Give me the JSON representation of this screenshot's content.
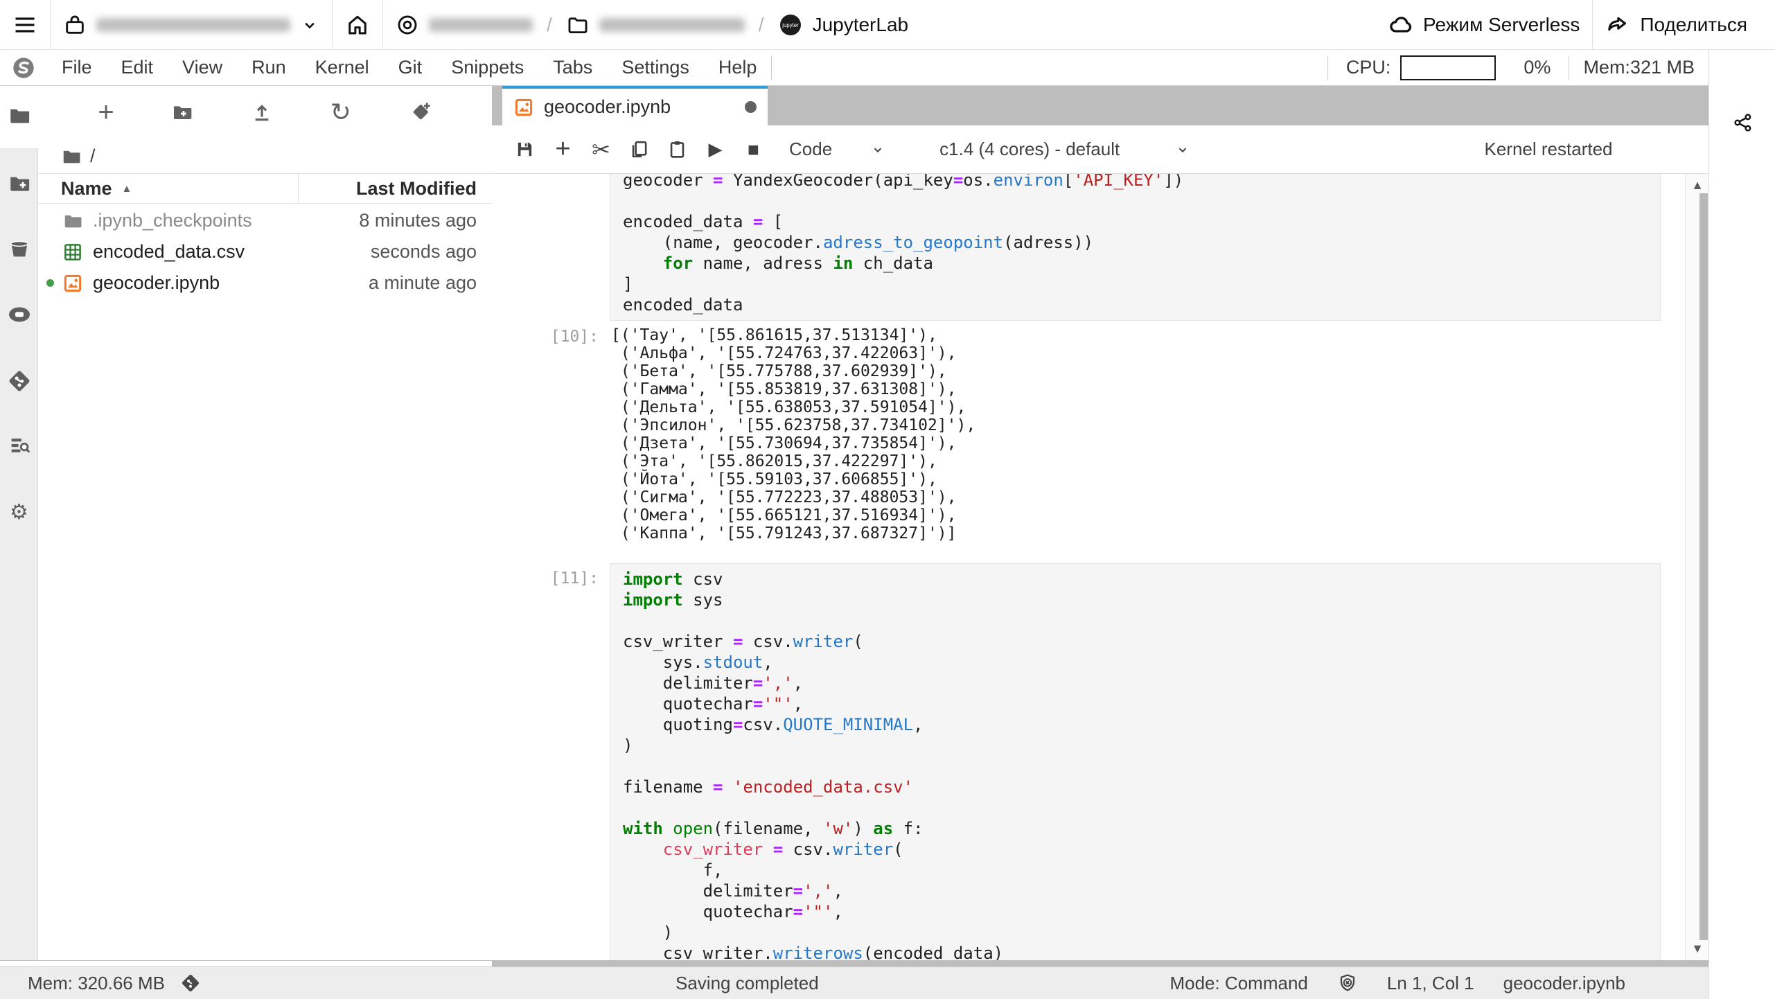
{
  "topbar": {
    "app_title": "JupyterLab",
    "breadcrumb_sep": "/",
    "serverless_label": "Режим Serverless",
    "share_label": "Поделиться"
  },
  "menubar": {
    "items": [
      "File",
      "Edit",
      "View",
      "Run",
      "Kernel",
      "Git",
      "Snippets",
      "Tabs",
      "Settings",
      "Help"
    ],
    "cpu_label": "CPU:",
    "cpu_value": "0%",
    "mem_label": "Mem:321 MB"
  },
  "filebrowser": {
    "path": "/",
    "columns": {
      "name": "Name",
      "modified": "Last Modified"
    },
    "files": [
      {
        "name": ".ipynb_checkpoints",
        "modified": "8 minutes ago",
        "type": "folder"
      },
      {
        "name": "encoded_data.csv",
        "modified": "seconds ago",
        "type": "csv"
      },
      {
        "name": "geocoder.ipynb",
        "modified": "a minute ago",
        "type": "notebook",
        "running": true
      }
    ]
  },
  "tab": {
    "title": "geocoder.ipynb"
  },
  "nbtoolbar": {
    "cell_type": "Code",
    "kernel": "c1.4 (4 cores) - default",
    "status": "Kernel restarted"
  },
  "icons": {
    "run": "▶",
    "stop": "■",
    "cut": "✂",
    "refresh": "↻",
    "add_launcher": "+",
    "sort_asc": "▲",
    "scroll_up": "▲",
    "scroll_down": "▼",
    "gears": "⚙"
  },
  "notebook": {
    "cells": [
      {
        "kind": "input",
        "prompt": "",
        "lines": [
          [
            [
              "",
              "geocoder "
            ],
            [
              "o",
              "="
            ],
            [
              "",
              " YandexGeocoder(api_key"
            ],
            [
              "o",
              "="
            ],
            [
              "",
              "os."
            ],
            [
              "b",
              "environ"
            ],
            [
              "",
              "["
            ],
            [
              "s",
              "'API_KEY'"
            ],
            [
              "",
              "])"
            ]
          ],
          [],
          [
            [
              "",
              "encoded_data "
            ],
            [
              "o",
              "="
            ],
            [
              "",
              " ["
            ]
          ],
          [
            [
              "",
              "    (name, geocoder."
            ],
            [
              "b",
              "adress_to_geopoint"
            ],
            [
              "",
              "(adress))"
            ]
          ],
          [
            [
              "",
              "    "
            ],
            [
              "k",
              "for"
            ],
            [
              "",
              " name, adress "
            ],
            [
              "k",
              "in"
            ],
            [
              "",
              " ch_data"
            ]
          ],
          [
            [
              "",
              "]"
            ]
          ],
          [
            [
              "",
              "encoded_data"
            ]
          ]
        ]
      },
      {
        "kind": "output",
        "prompt": "[10]:",
        "lines": [
          "[('Тау', '[55.861615,37.513134]'),",
          " ('Альфа', '[55.724763,37.422063]'),",
          " ('Бета', '[55.775788,37.602939]'),",
          " ('Гамма', '[55.853819,37.631308]'),",
          " ('Дельта', '[55.638053,37.591054]'),",
          " ('Эпсилон', '[55.623758,37.734102]'),",
          " ('Дзета', '[55.730694,37.735854]'),",
          " ('Эта', '[55.862015,37.422297]'),",
          " ('Йота', '[55.59103,37.606855]'),",
          " ('Сигма', '[55.772223,37.488053]'),",
          " ('Омега', '[55.665121,37.516934]'),",
          " ('Каппа', '[55.791243,37.687327]')]"
        ]
      },
      {
        "kind": "input",
        "prompt": "[11]:",
        "lines": [
          [
            [
              "k",
              "import"
            ],
            [
              "",
              " csv"
            ]
          ],
          [
            [
              "k",
              "import"
            ],
            [
              "",
              " sys"
            ]
          ],
          [],
          [
            [
              "",
              "csv_writer "
            ],
            [
              "o",
              "="
            ],
            [
              "",
              " csv."
            ],
            [
              "b",
              "writer"
            ],
            [
              "",
              "("
            ]
          ],
          [
            [
              "",
              "    sys."
            ],
            [
              "b",
              "stdout"
            ],
            [
              "",
              ","
            ]
          ],
          [
            [
              "",
              "    delimiter"
            ],
            [
              "o",
              "="
            ],
            [
              "s",
              "','"
            ],
            [
              "",
              ","
            ]
          ],
          [
            [
              "",
              "    quotechar"
            ],
            [
              "o",
              "="
            ],
            [
              "s",
              "'\"'"
            ],
            [
              "",
              ","
            ]
          ],
          [
            [
              "",
              "    quoting"
            ],
            [
              "o",
              "="
            ],
            [
              "",
              "csv."
            ],
            [
              "b",
              "QUOTE_MINIMAL"
            ],
            [
              "",
              ","
            ]
          ],
          [
            [
              "",
              ")"
            ]
          ],
          [],
          [
            [
              "",
              "filename "
            ],
            [
              "o",
              "="
            ],
            [
              "",
              " "
            ],
            [
              "s",
              "'encoded_data.csv'"
            ]
          ],
          [],
          [
            [
              "k",
              "with"
            ],
            [
              "",
              " "
            ],
            [
              "g",
              "open"
            ],
            [
              "",
              "(filename, "
            ],
            [
              "s",
              "'w'"
            ],
            [
              "",
              ") "
            ],
            [
              "k",
              "as"
            ],
            [
              "",
              " f:"
            ]
          ],
          [
            [
              "",
              "    "
            ],
            [
              "v",
              "csv_writer"
            ],
            [
              "",
              " "
            ],
            [
              "o",
              "="
            ],
            [
              "",
              " csv."
            ],
            [
              "b",
              "writer"
            ],
            [
              "",
              "("
            ]
          ],
          [
            [
              "",
              "        f,"
            ]
          ],
          [
            [
              "",
              "        delimiter"
            ],
            [
              "o",
              "="
            ],
            [
              "s",
              "','"
            ],
            [
              "",
              ","
            ]
          ],
          [
            [
              "",
              "        quotechar"
            ],
            [
              "o",
              "="
            ],
            [
              "s",
              "'\"'"
            ],
            [
              "",
              ","
            ]
          ],
          [
            [
              "",
              "    )"
            ]
          ],
          [
            [
              "",
              "    csv_writer."
            ],
            [
              "b",
              "writerows"
            ],
            [
              "",
              "(encoded_data)"
            ]
          ]
        ]
      }
    ]
  },
  "statusbar": {
    "mem": "Mem: 320.66 MB",
    "saving": "Saving completed",
    "mode": "Mode: Command",
    "position": "Ln 1, Col 1",
    "file": "geocoder.ipynb"
  }
}
